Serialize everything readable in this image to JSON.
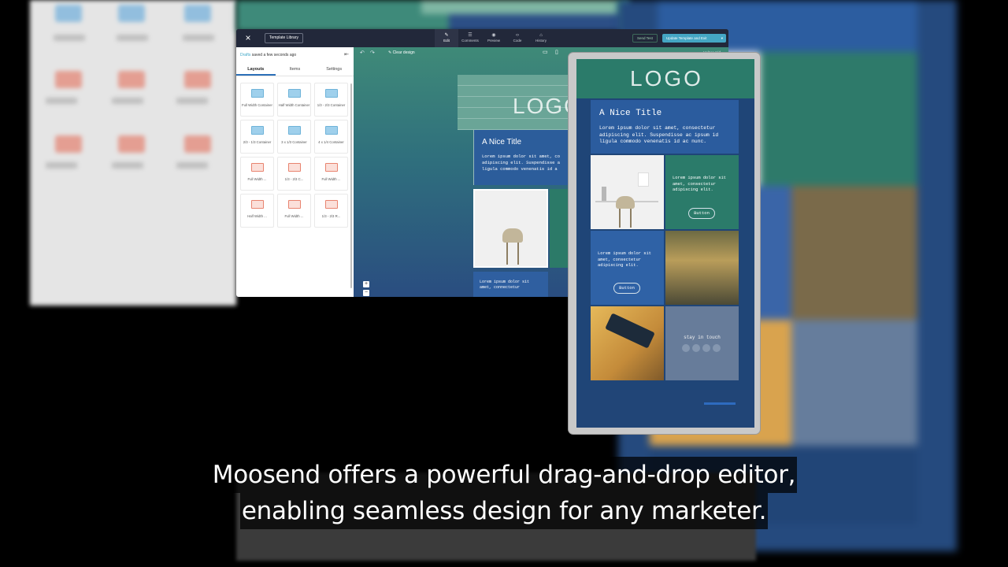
{
  "caption": {
    "line1": "Moosend offers a powerful drag-and-drop editor,",
    "line2": "enabling seamless design for any marketer."
  },
  "editor": {
    "close_icon": "×",
    "template_library_label": "Template Library",
    "tabs": [
      {
        "icon": "✎",
        "label": "Edit"
      },
      {
        "icon": "☰",
        "label": "Comments"
      },
      {
        "icon": "◉",
        "label": "Preview"
      },
      {
        "icon": "‹›",
        "label": "Code"
      },
      {
        "icon": "⌂",
        "label": "History"
      }
    ],
    "send_test_label": "Send Test",
    "update_label": "Update Template and Exit",
    "update_chevron": "▾",
    "draft_status_prefix": "Drafts",
    "draft_status_text": "saved a few seconds ago",
    "draft_menu_icon": "⇤",
    "panel_tabs": [
      "Layouts",
      "Items",
      "Settings"
    ],
    "layouts": [
      {
        "label": "Full Width Container",
        "color": "blue"
      },
      {
        "label": "Half Width Container",
        "color": "blue"
      },
      {
        "label": "1/3 - 2/3 Container",
        "color": "blue"
      },
      {
        "label": "2/3 - 1/3 Container",
        "color": "blue"
      },
      {
        "label": "3 x 1/3 Container",
        "color": "blue"
      },
      {
        "label": "4 x 1/4 Container",
        "color": "blue"
      },
      {
        "label": "Full Width ...",
        "color": "red"
      },
      {
        "label": "1/3 - 2/3 C...",
        "color": "red"
      },
      {
        "label": "Full Width ...",
        "color": "red"
      },
      {
        "label": "Half Width ...",
        "color": "red"
      },
      {
        "label": "Full Width ...",
        "color": "red"
      },
      {
        "label": "1/3 - 2/3 R...",
        "color": "red"
      }
    ],
    "undo_icon": "↶",
    "redo_icon": "↷",
    "clear_design_label": "✎ Clear design",
    "desktop_icon": "▭",
    "mobile_icon": "▯",
    "helper_grid_label": "Helper grid",
    "zoom_in": "+",
    "zoom_out": "−",
    "canvas_email": {
      "logo": "LOGO",
      "title": "A Nice Title",
      "lorem": "Lorem ipsum dolor sit amet, co\nadipiscing elit. Suspendisse a\nligula commodo venenatis id a",
      "lorem_small": "Lorem ipsum dolor sit\namet, connectetur"
    }
  },
  "phone": {
    "logo": "LOGO",
    "title": "A Nice Title",
    "lorem": "Lorem ipsum dolor sit amet, consectetur\nadipiscing elit. Suspendisse ac ipsum id\nligula commodo venenatis id ac nunc.",
    "cell_text_1": "Lorem ipsum dolor sit\namet, consectetur\nadipiscing elit.",
    "button_1": "Button",
    "cell_text_2": "Lorem ipsum dolor sit\namet, consectetur\nadipiscing elit.",
    "button_2": "Button",
    "stay_in_touch": "stay in touch"
  },
  "colors": {
    "editor_bg": "#23283a",
    "accent_teal": "#2b7b6a",
    "accent_blue": "#2b5c9e",
    "update_button": "#44a6c4"
  }
}
